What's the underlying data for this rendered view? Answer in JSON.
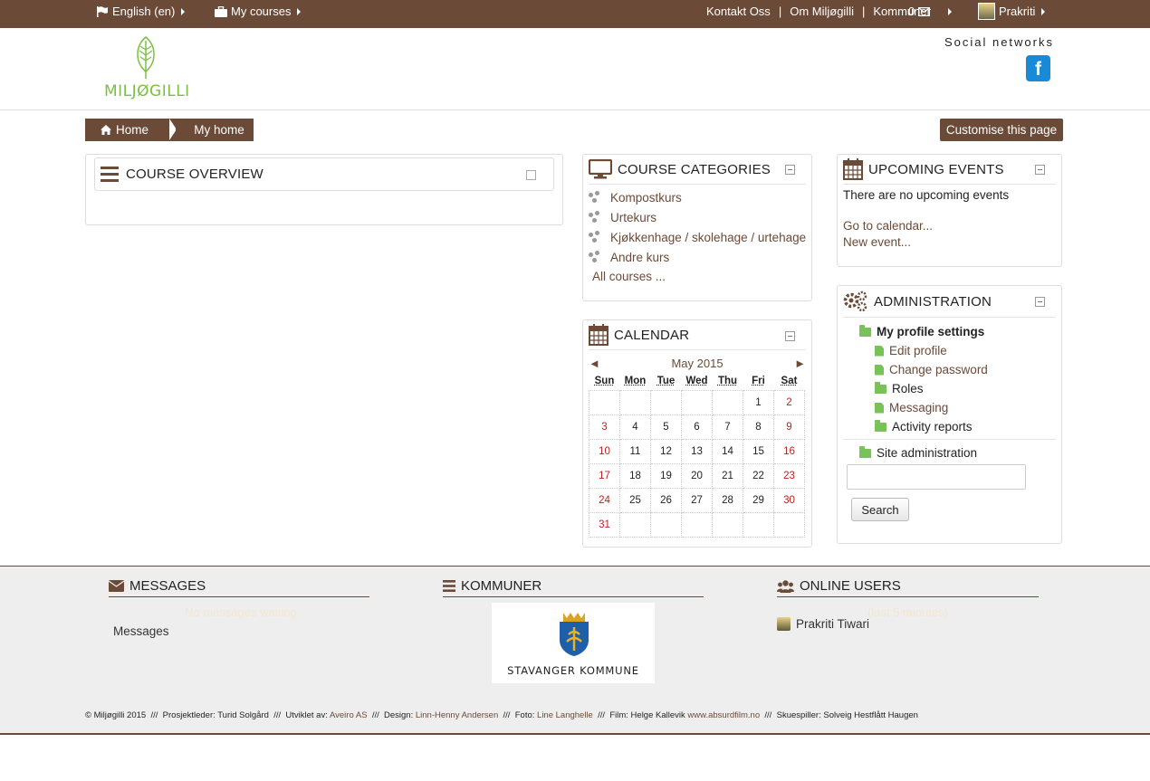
{
  "topbar": {
    "language": "English (en)",
    "my_courses": "My courses",
    "links": [
      "Kontakt Oss",
      "Om Miljøgilli",
      "Kommuner"
    ],
    "message_count": "0",
    "user": "Prakriti"
  },
  "header": {
    "logo_text": "MILJØGILLI",
    "social_title": "Social networks",
    "facebook_letter": "f"
  },
  "breadcrumb": {
    "home": "Home",
    "current": "My home"
  },
  "customise_button": "Customise this page",
  "course_overview": {
    "title": "COURSE OVERVIEW"
  },
  "course_categories": {
    "title": "COURSE CATEGORIES",
    "items": [
      "Kompostkurs",
      "Urtekurs",
      "Kjøkkenhage / skolehage / urtehage",
      "Andre kurs"
    ],
    "all_courses": "All courses ..."
  },
  "calendar": {
    "title": "CALENDAR",
    "month": "May 2015",
    "prev": "◄",
    "next": "►",
    "days": [
      "Sun",
      "Mon",
      "Tue",
      "Wed",
      "Thu",
      "Fri",
      "Sat"
    ],
    "weeks": [
      [
        "",
        "",
        "",
        "",
        "",
        "1",
        "2"
      ],
      [
        "3",
        "4",
        "5",
        "6",
        "7",
        "8",
        "9"
      ],
      [
        "10",
        "11",
        "12",
        "13",
        "14",
        "15",
        "16"
      ],
      [
        "17",
        "18",
        "19",
        "20",
        "21",
        "22",
        "23"
      ],
      [
        "24",
        "25",
        "26",
        "27",
        "28",
        "29",
        "30"
      ],
      [
        "31",
        "",
        "",
        "",
        "",
        "",
        ""
      ]
    ]
  },
  "upcoming_events": {
    "title": "UPCOMING EVENTS",
    "empty_text": "There are no upcoming events",
    "go_to_calendar": "Go to calendar...",
    "new_event": "New event..."
  },
  "administration": {
    "title": "ADMINISTRATION",
    "profile_settings": "My profile settings",
    "edit_profile": "Edit profile",
    "change_password": "Change password",
    "roles": "Roles",
    "messaging": "Messaging",
    "activity_reports": "Activity reports",
    "site_admin": "Site administration",
    "search_value": "",
    "search_button": "Search"
  },
  "footer": {
    "messages_title": "MESSAGES",
    "no_messages": "No messages waiting",
    "messages_link": "Messages",
    "kommuner_title": "KOMMUNER",
    "kommune_name": "STAVANGER KOMMUNE",
    "online_title": "ONLINE USERS",
    "online_period": "(last 5 minutes)",
    "online_user": "Prakriti Tiwari",
    "credits": {
      "copyright": "© Miljøgilli 2015",
      "prosjekt": "Prosjektleder: Turid Solgård",
      "utviklet_label": "Utviklet av:",
      "utviklet": "Aveiro AS",
      "design_label": "Design:",
      "design": "Linn-Henny Andersen",
      "foto_label": "Foto:",
      "foto": "Line Langhelle",
      "film_label": "Film: Helge Kallevik",
      "film_link": "www.absurdfilm.no",
      "skuespiller": "Skuespiller: Solveig Hestflått Haugen",
      "divider": "///"
    }
  },
  "colors": {
    "brand": "#6b4a38",
    "accent_green": "#78c257",
    "weekend": "#b22222",
    "facebook": "#1a8ad6"
  }
}
